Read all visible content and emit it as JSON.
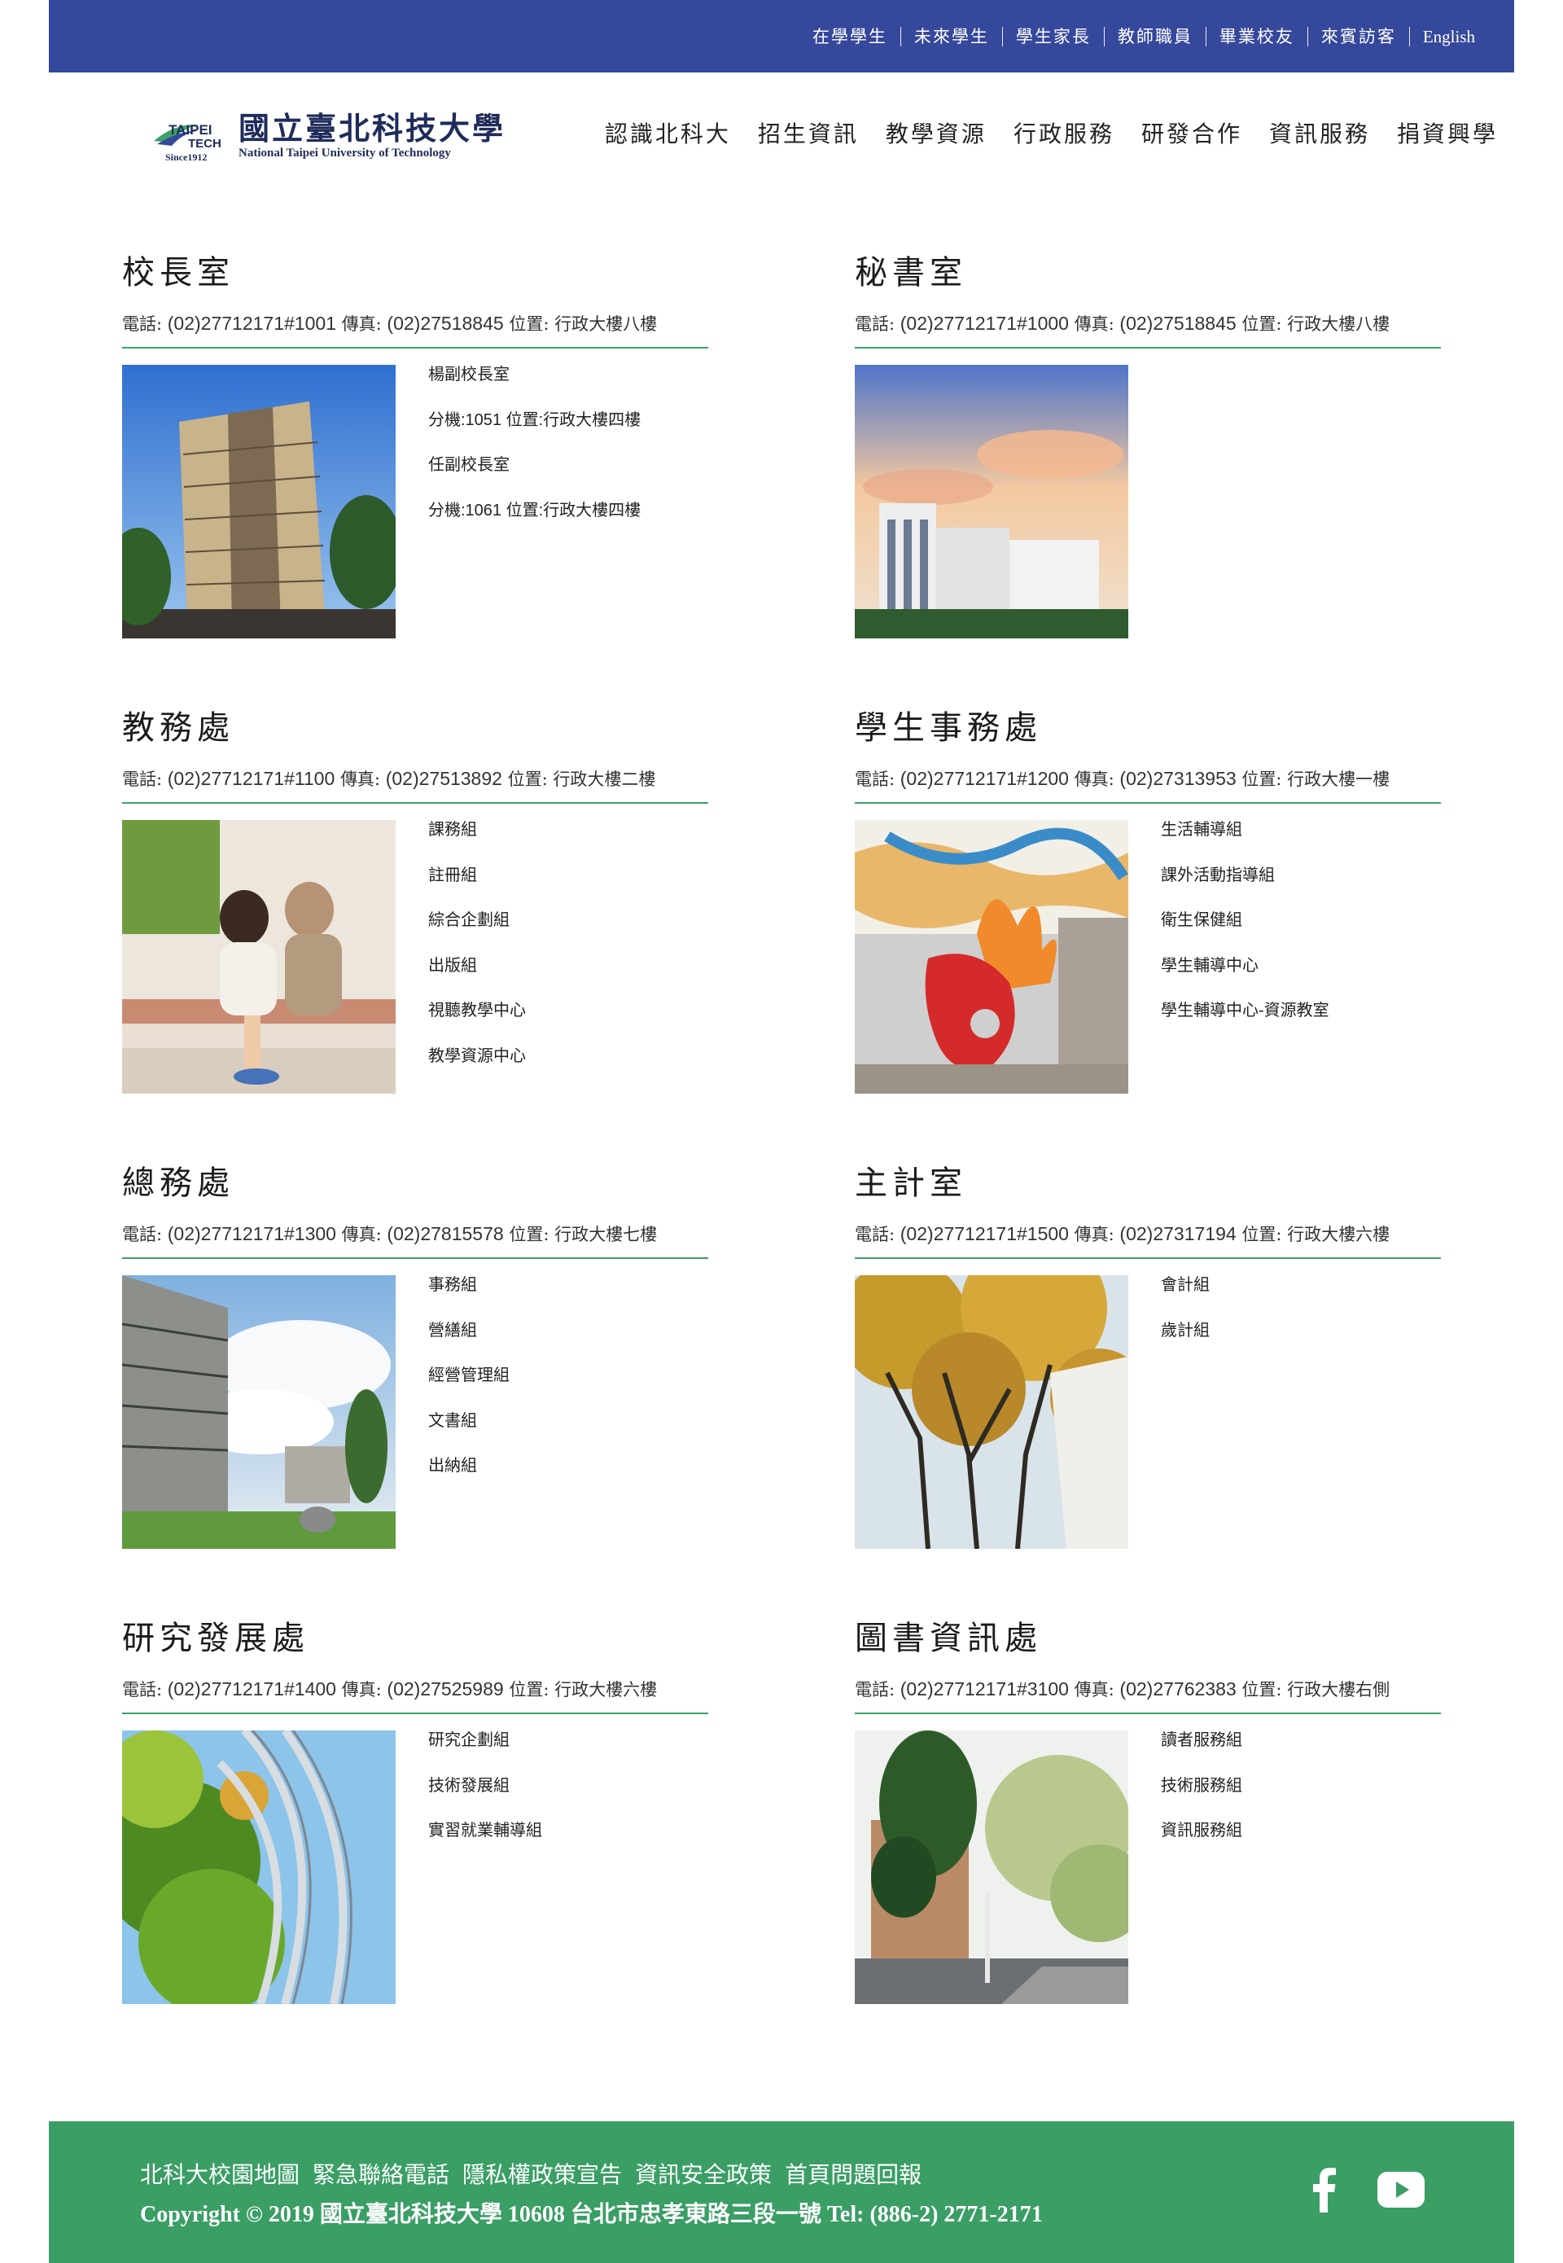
{
  "topbar": {
    "links": [
      "在學學生",
      "未來學生",
      "學生家長",
      "教師職員",
      "畢業校友",
      "來賓訪客"
    ],
    "english": "English"
  },
  "header": {
    "logo_cn": "國立臺北科技大學",
    "logo_en": "National Taipei University of Technology",
    "logo_badge_top": "TAIPEI",
    "logo_badge_mid": "TECH",
    "logo_badge_since": "Since1912",
    "nav": [
      "認識北科大",
      "招生資訊",
      "教學資源",
      "行政服務",
      "研發合作",
      "資訊服務",
      "捐資興學"
    ]
  },
  "labels": {
    "phone": "電話:",
    "fax": "傳真:",
    "location": "位置:"
  },
  "offices": [
    {
      "name": "校長室",
      "phone": "(02)27712171#1001",
      "fax": "(02)27518845",
      "location": "行政大樓八樓",
      "units": [
        "楊副校長室",
        "分機:1051 位置:行政大樓四樓",
        "任副校長室",
        "分機:1061 位置:行政大樓四樓"
      ]
    },
    {
      "name": "秘書室",
      "phone": "(02)27712171#1000",
      "fax": "(02)27518845",
      "location": "行政大樓八樓",
      "units": []
    },
    {
      "name": "教務處",
      "phone": "(02)27712171#1100",
      "fax": "(02)27513892",
      "location": "行政大樓二樓",
      "units": [
        "課務組",
        "註冊組",
        "綜合企劃組",
        "出版組",
        "視聽教學中心",
        "教學資源中心"
      ]
    },
    {
      "name": "學生事務處",
      "phone": "(02)27712171#1200",
      "fax": "(02)27313953",
      "location": "行政大樓一樓",
      "units": [
        "生活輔導組",
        "課外活動指導組",
        "衛生保健組",
        "學生輔導中心",
        "學生輔導中心-資源教室"
      ]
    },
    {
      "name": "總務處",
      "phone": "(02)27712171#1300",
      "fax": "(02)27815578",
      "location": "行政大樓七樓",
      "units": [
        "事務組",
        "營繕組",
        "經營管理組",
        "文書組",
        "出納組"
      ]
    },
    {
      "name": "主計室",
      "phone": "(02)27712171#1500",
      "fax": "(02)27317194",
      "location": "行政大樓六樓",
      "units": [
        "會計組",
        "歲計組"
      ]
    },
    {
      "name": "研究發展處",
      "phone": "(02)27712171#1400",
      "fax": "(02)27525989",
      "location": "行政大樓六樓",
      "units": [
        "研究企劃組",
        "技術發展組",
        "實習就業輔導組"
      ]
    },
    {
      "name": "圖書資訊處",
      "phone": "(02)27712171#3100",
      "fax": "(02)27762383",
      "location": "行政大樓右側",
      "units": [
        "讀者服務組",
        "技術服務組",
        "資訊服務組"
      ]
    }
  ],
  "footer": {
    "links": [
      "北科大校園地圖",
      "緊急聯絡電話",
      "隱私權政策宣告",
      "資訊安全政策",
      "首頁問題回報"
    ],
    "copyright": "Copyright © 2019 國立臺北科技大學 10608 台北市忠孝東路三段一號 Tel: (886-2) 2771-2171"
  },
  "colors": {
    "topbar": "#35489b",
    "accent": "#3ca068",
    "footer": "#3a9e65"
  },
  "icons": [
    "facebook-icon",
    "youtube-icon"
  ]
}
